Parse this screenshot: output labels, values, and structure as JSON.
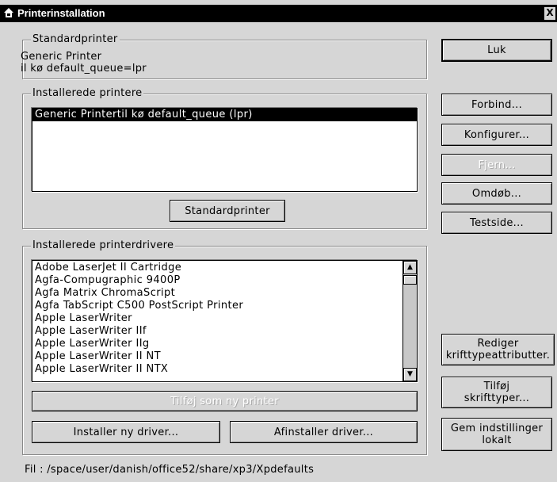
{
  "window": {
    "title": "Printerinstallation",
    "close_glyph": "X"
  },
  "default_printer_group": {
    "legend": "Standardprinter",
    "name": "Generic Printer",
    "queue": "il kø default_queue=lpr"
  },
  "installed_printers_group": {
    "legend": "Installerede printere",
    "items": [
      "Generic Printertil kø default_queue (lpr)"
    ],
    "selected_index": 0,
    "set_default_button": "Standardprinter"
  },
  "drivers_group": {
    "legend": "Installerede printerdrivere",
    "items": [
      "Adobe LaserJet II Cartridge",
      "Agfa-Compugraphic 9400P",
      "Agfa Matrix ChromaScript",
      "Agfa TabScript C500 PostScript Printer",
      "Apple LaserWriter",
      "Apple LaserWriter IIf",
      "Apple LaserWriter IIg",
      "Apple LaserWriter II NT",
      "Apple LaserWriter II NTX"
    ],
    "add_as_printer_button": "Tilføj som ny printer",
    "install_driver_button": "Installer ny driver...",
    "uninstall_driver_button": "Afinstaller driver..."
  },
  "side_buttons": {
    "close": "Luk",
    "connect": "Forbind...",
    "configure": "Konfigurer...",
    "remove": "Fjern...",
    "rename": "Omdøb...",
    "test_page": "Testside...",
    "edit_font_attrs_1": "Rediger",
    "edit_font_attrs_2": "krifttypeattributter.",
    "add_fonts_1": "Tilføj",
    "add_fonts_2": "skrifttyper...",
    "save_local_1": "Gem indstillinger",
    "save_local_2": "lokalt"
  },
  "status": {
    "file_path": "Fil : /space/user/danish/office52/share/xp3/Xpdefaults"
  },
  "icons": {
    "title_icon": "printer-app-icon",
    "scroll_up": "arrow-up-icon",
    "scroll_down": "arrow-down-icon"
  }
}
